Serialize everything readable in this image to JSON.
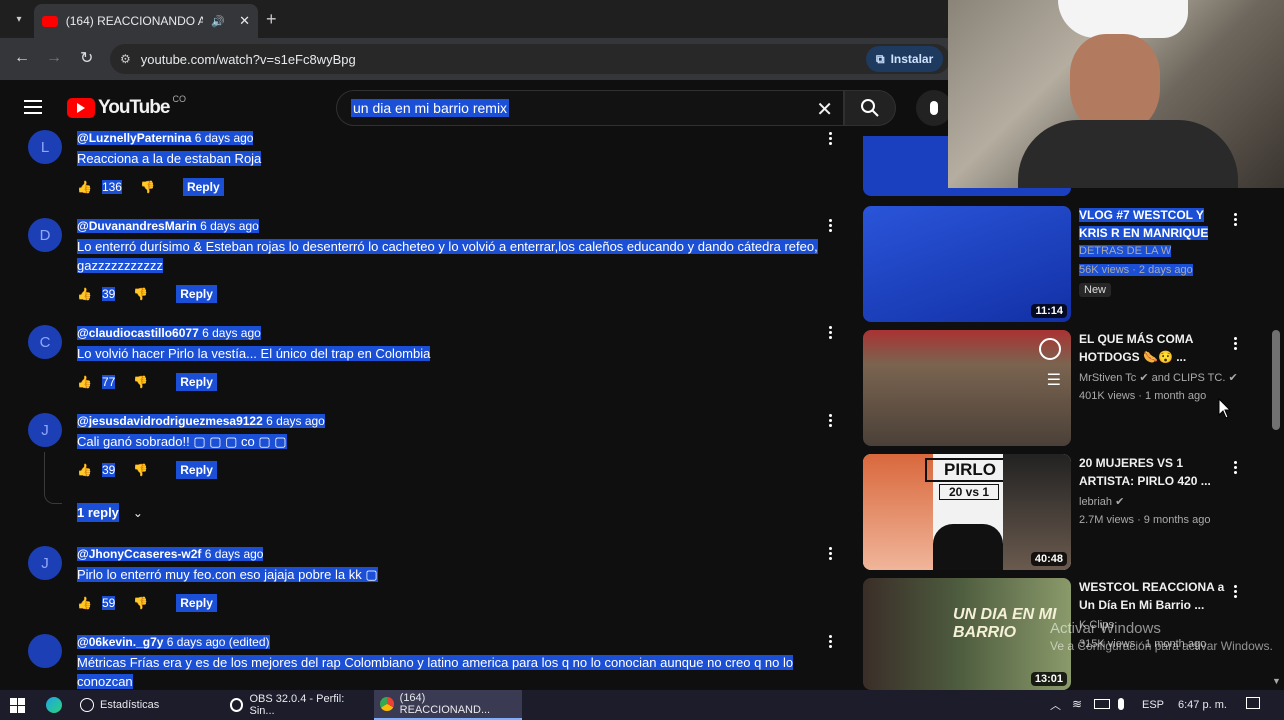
{
  "browser": {
    "tab_title": "(164) REACCIONANDO A LA",
    "url": "youtube.com/watch?v=s1eFc8wyBpg",
    "install_label": "Instalar"
  },
  "youtube": {
    "logo_text": "YouTube",
    "country": "CO",
    "search_query": "un dia en mi barrio remix"
  },
  "comments": [
    {
      "avatar": "L",
      "author": "@LuznellyPaternina",
      "date": "6 days ago",
      "text": "Reacciona a la de estaban Roja",
      "likes": "136",
      "reply_label": "Reply"
    },
    {
      "avatar": "D",
      "author": "@DuvanandresMarin",
      "date": "6 days ago",
      "text": "Lo enterró durísimo & Esteban rojas lo desenterró lo cacheteo y lo volvió a enterrar,los caleños educando y dando cátedra refeo, gazzzzzzzzzzz",
      "likes": "39",
      "reply_label": "Reply"
    },
    {
      "avatar": "C",
      "author": "@claudiocastillo6077",
      "date": "6 days ago",
      "text": "Lo volvió hacer Pirlo la vestía... El único del trap en Colombia",
      "likes": "77",
      "reply_label": "Reply"
    },
    {
      "avatar": "J",
      "author": "@jesusdavidrodriguezmesa9122",
      "date": "6 days ago",
      "text": "Cali ganó sobrado!!",
      "text_suffix": "co",
      "likes": "39",
      "reply_label": "Reply",
      "replies_label": "1 reply"
    },
    {
      "avatar": "J",
      "author": "@JhonyCcaseres-w2f",
      "date": "6 days ago",
      "text": "Pirlo lo enterró muy feo.con eso jajaja pobre la kk",
      "likes": "59",
      "reply_label": "Reply"
    },
    {
      "avatar": "",
      "author": "@06kevin._g7y",
      "date": "6 days ago (edited)",
      "text": "Métricas Frías era y es de los mejores del rap Colombiano y latino america para los q no lo conocian aunque no creo q no lo conozcan"
    }
  ],
  "videos": [
    {
      "title": "VLOG #7 WESTCOL Y KRIS R EN MANRIQUE",
      "channel": "DETRAS DE LA W",
      "meta": "56K views · 2 days ago",
      "badge": "New",
      "duration": "11:14",
      "thumb_color": "#1a3fbf"
    },
    {
      "title": "EL QUE MÁS COMA HOTDOGS 🌭😯 ...",
      "channel": "MrStiven Tc",
      "channel_extra": "and CLIPS TC.",
      "meta": "401K views · 1 month ago",
      "duration": "",
      "thumb_color": "#6b5a4a"
    },
    {
      "title": "20 MUJERES VS 1 ARTISTA: PIRLO 420 ...",
      "channel": "lebriah",
      "meta": "2.7M views · 9 months ago",
      "duration": "40:48",
      "thumb_color": "#f2f2f2",
      "thumb_text_1": "PIRLO",
      "thumb_text_2": "20 vs 1"
    },
    {
      "title": "WESTCOL REACCIONA a Un Día En Mi Barrio ...",
      "channel": "K Clips",
      "meta": "315K views · 1 month ago",
      "duration": "13:01",
      "thumb_color": "#2e3b2e",
      "thumb_text_1": "UN DIA EN MI BARRIO"
    }
  ],
  "watermark": {
    "line1": "Activar Windows",
    "line2": "Ve a Configuración para activar Windows."
  },
  "taskbar": {
    "items": [
      "Estadísticas",
      "OBS 32.0.4 - Perfil: Sin...",
      "(164) REACCIONAND..."
    ],
    "lang": "ESP",
    "time": "6:47 p. m."
  },
  "colors": {
    "selection": "#1a4fd6",
    "background": "#0f0f0f",
    "brand_red": "#ff0000"
  }
}
